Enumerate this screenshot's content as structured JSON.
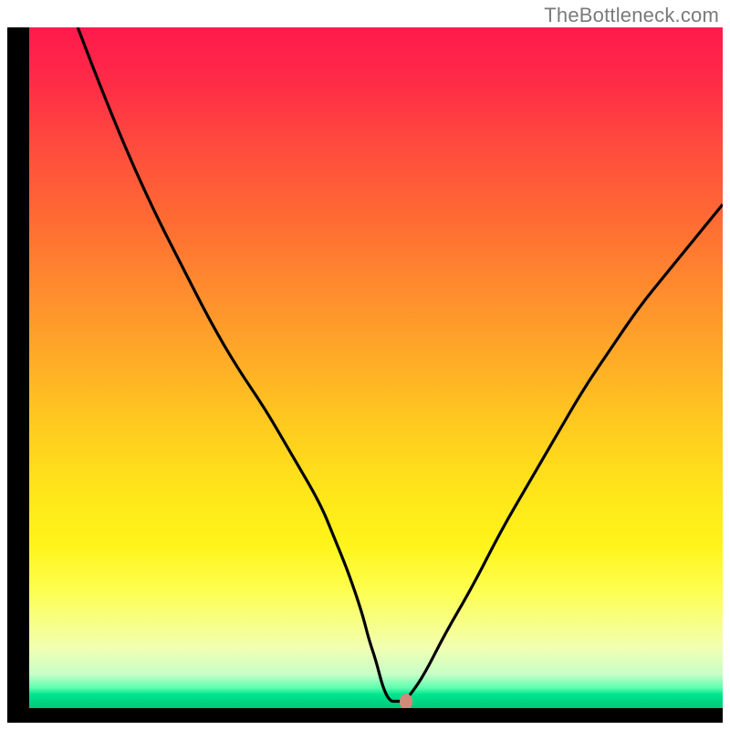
{
  "attribution": "TheBottleneck.com",
  "chart_data": {
    "type": "line",
    "title": "",
    "xlabel": "",
    "ylabel": "",
    "xlim": [
      0,
      100
    ],
    "ylim": [
      0,
      100
    ],
    "x": [
      7,
      10,
      14,
      18,
      22,
      26,
      30,
      34,
      38,
      42,
      44,
      46,
      48,
      49,
      50,
      51,
      52,
      53,
      54,
      55,
      57,
      60,
      64,
      68,
      72,
      76,
      80,
      84,
      88,
      92,
      96,
      100
    ],
    "y": [
      100,
      92,
      82,
      73,
      65,
      57,
      50,
      44,
      37,
      30,
      25,
      20,
      14,
      10,
      7,
      3,
      1,
      1,
      1,
      2,
      5,
      11,
      18,
      26,
      33,
      40,
      47,
      53,
      59,
      64,
      69,
      74
    ],
    "marker": {
      "x": 54.3,
      "y": 1.0
    }
  },
  "colors": {
    "curve": "#000000",
    "marker": "#d18a7a",
    "frame": "#000000"
  }
}
